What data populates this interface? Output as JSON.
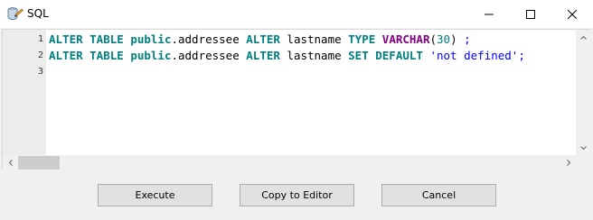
{
  "window": {
    "title": "SQL",
    "controls": {
      "minimize": "minimize-icon",
      "maximize": "maximize-icon",
      "close": "close-icon"
    }
  },
  "editor": {
    "line_numbers": [
      "1",
      "2",
      "3"
    ],
    "lines": [
      [
        {
          "text": "ALTER TABLE ",
          "kind": "kw"
        },
        {
          "text": "public",
          "kind": "kw-schema"
        },
        {
          "text": ".addressee ",
          "kind": "plain"
        },
        {
          "text": "ALTER ",
          "kind": "kw"
        },
        {
          "text": "lastname ",
          "kind": "plain"
        },
        {
          "text": "TYPE ",
          "kind": "kw"
        },
        {
          "text": "VARCHAR",
          "kind": "type"
        },
        {
          "text": "(",
          "kind": "plain"
        },
        {
          "text": "30",
          "kind": "num"
        },
        {
          "text": ") ",
          "kind": "plain"
        },
        {
          "text": ";",
          "kind": "punct"
        }
      ],
      [
        {
          "text": "ALTER TABLE ",
          "kind": "kw"
        },
        {
          "text": "public",
          "kind": "kw-schema"
        },
        {
          "text": ".addressee ",
          "kind": "plain"
        },
        {
          "text": "ALTER ",
          "kind": "kw"
        },
        {
          "text": "lastname ",
          "kind": "plain"
        },
        {
          "text": "SET DEFAULT ",
          "kind": "kw"
        },
        {
          "text": "'not defined'",
          "kind": "str"
        },
        {
          "text": ";",
          "kind": "punct"
        }
      ],
      []
    ]
  },
  "buttons": {
    "execute": "Execute",
    "copy_to_editor": "Copy to Editor",
    "cancel": "Cancel"
  },
  "colors": {
    "keyword": "#008080",
    "type": "#800080",
    "string": "#0000ff"
  }
}
